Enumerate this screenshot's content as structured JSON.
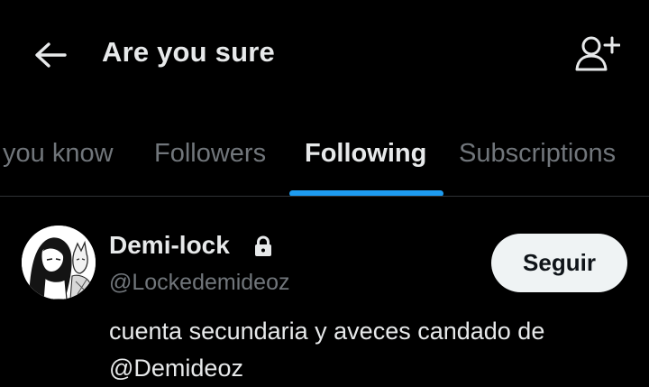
{
  "header": {
    "title": "Are you sure",
    "back_icon": "arrow-left-icon",
    "add_icon": "add-user-icon"
  },
  "tabs": [
    {
      "label": "you know",
      "active": false
    },
    {
      "label": "Followers",
      "active": false
    },
    {
      "label": "Following",
      "active": true
    },
    {
      "label": "Subscriptions",
      "active": false
    }
  ],
  "colors": {
    "background": "#000000",
    "accent": "#1d9bf0",
    "text": "#e7e9ea",
    "muted": "#71767b",
    "button_bg": "#eff3f4"
  },
  "user": {
    "name": "Demi-lock",
    "locked": true,
    "lock_icon": "lock-icon",
    "handle": "@Lockedemideoz",
    "follow_label": "Seguir",
    "bio_line1": "cuenta secundaria y aveces candado de",
    "bio_line2": "@Demideoz"
  }
}
